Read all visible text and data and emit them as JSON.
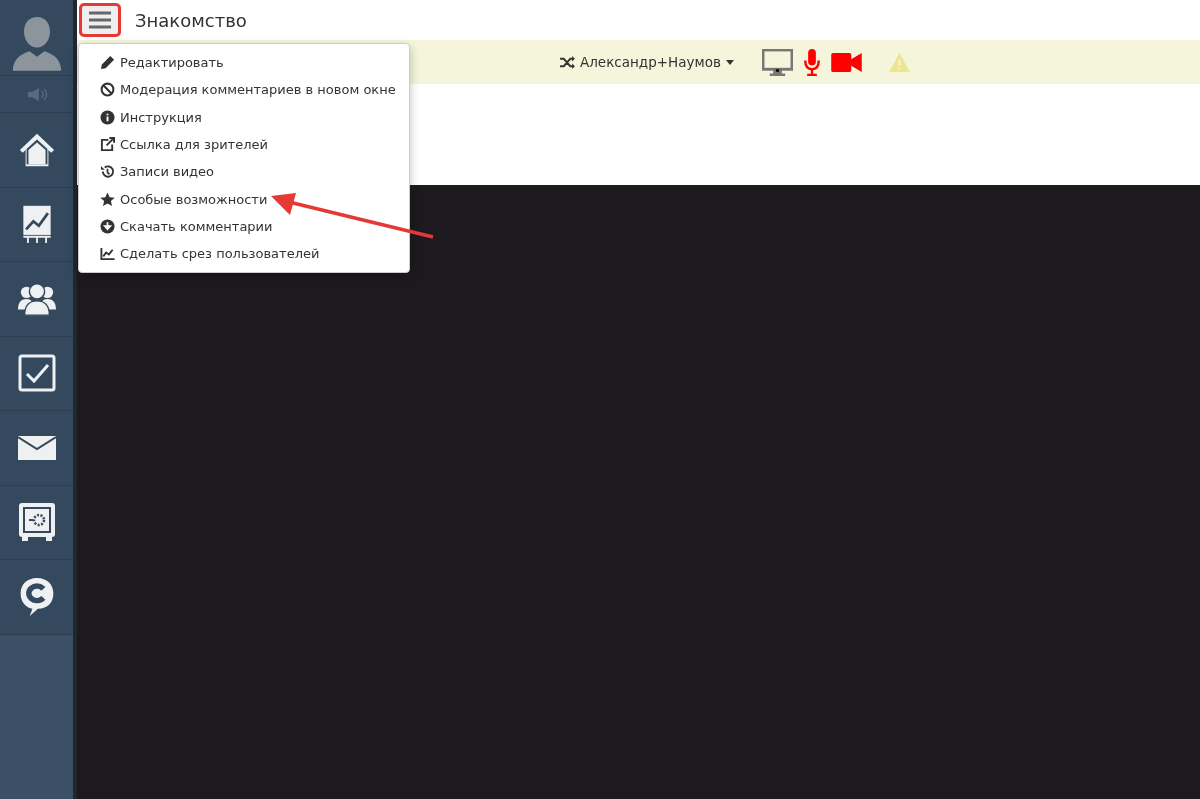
{
  "sidebar": {
    "items": [
      {
        "kind": "home"
      },
      {
        "kind": "chart"
      },
      {
        "kind": "people"
      },
      {
        "kind": "check"
      },
      {
        "kind": "mail"
      },
      {
        "kind": "safe"
      },
      {
        "kind": "chat"
      }
    ]
  },
  "header": {
    "title": "Знакомство"
  },
  "toolbar": {
    "user": "Александр+Наумов"
  },
  "menu": {
    "items": [
      {
        "kind": "edit",
        "label": "Редактировать"
      },
      {
        "kind": "ban",
        "label": "Модерация комментариев в новом окне"
      },
      {
        "kind": "info",
        "label": "Инструкция"
      },
      {
        "kind": "external",
        "label": "Ссылка для зрителей"
      },
      {
        "kind": "history",
        "label": "Записи видео"
      },
      {
        "kind": "star",
        "label": "Особые возможности"
      },
      {
        "kind": "download",
        "label": "Скачать комментарии"
      },
      {
        "kind": "chart",
        "label": "Сделать срез пользователей"
      }
    ]
  }
}
